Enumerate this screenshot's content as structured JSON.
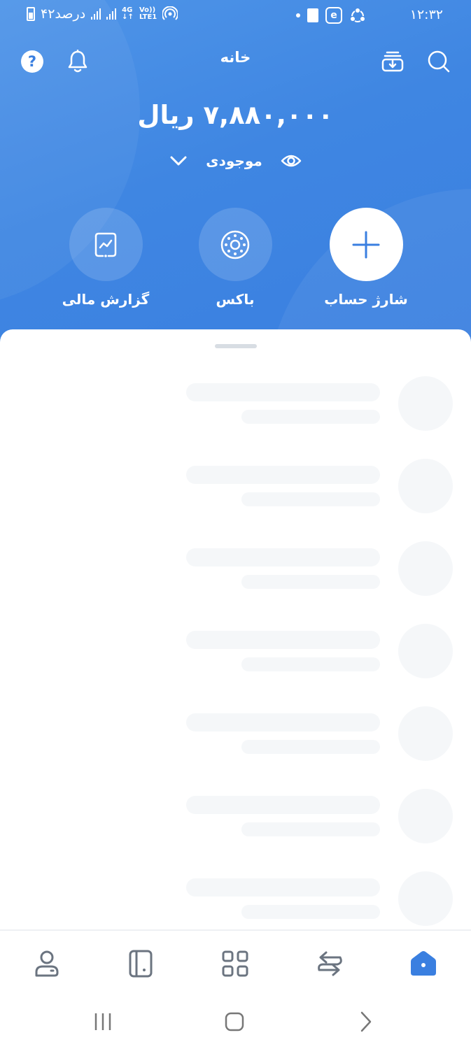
{
  "status_bar": {
    "time": "۱۲:۳۲",
    "battery_text": "۴۲درصد",
    "network_top": "4G",
    "network_bottom": "LTE1",
    "volte": "Vo))"
  },
  "header": {
    "title": "خانه"
  },
  "balance": {
    "amount": "۷,۸۸۰,۰۰۰ ریال",
    "toggle_label": "موجودی"
  },
  "actions": [
    {
      "label": "شارژ حساب",
      "icon": "plus-icon"
    },
    {
      "label": "باکس",
      "icon": "box-dial-icon"
    },
    {
      "label": "گزارش مالی",
      "icon": "chart-report-icon"
    }
  ],
  "bottom_nav": [
    {
      "name": "home",
      "icon": "home-icon",
      "active": true
    },
    {
      "name": "transfer",
      "icon": "transfer-arrows-icon",
      "active": false
    },
    {
      "name": "services",
      "icon": "grid-icon",
      "active": false
    },
    {
      "name": "cards",
      "icon": "card-icon",
      "active": false
    },
    {
      "name": "profile",
      "icon": "user-icon",
      "active": false
    }
  ],
  "colors": {
    "brand_blue": "#3a7fe0",
    "active_tab": "#3a7fe0",
    "inactive_tab": "#6b7480",
    "skeleton": "#f5f7f9"
  },
  "sheet": {
    "loading_skeleton_rows": 7
  }
}
